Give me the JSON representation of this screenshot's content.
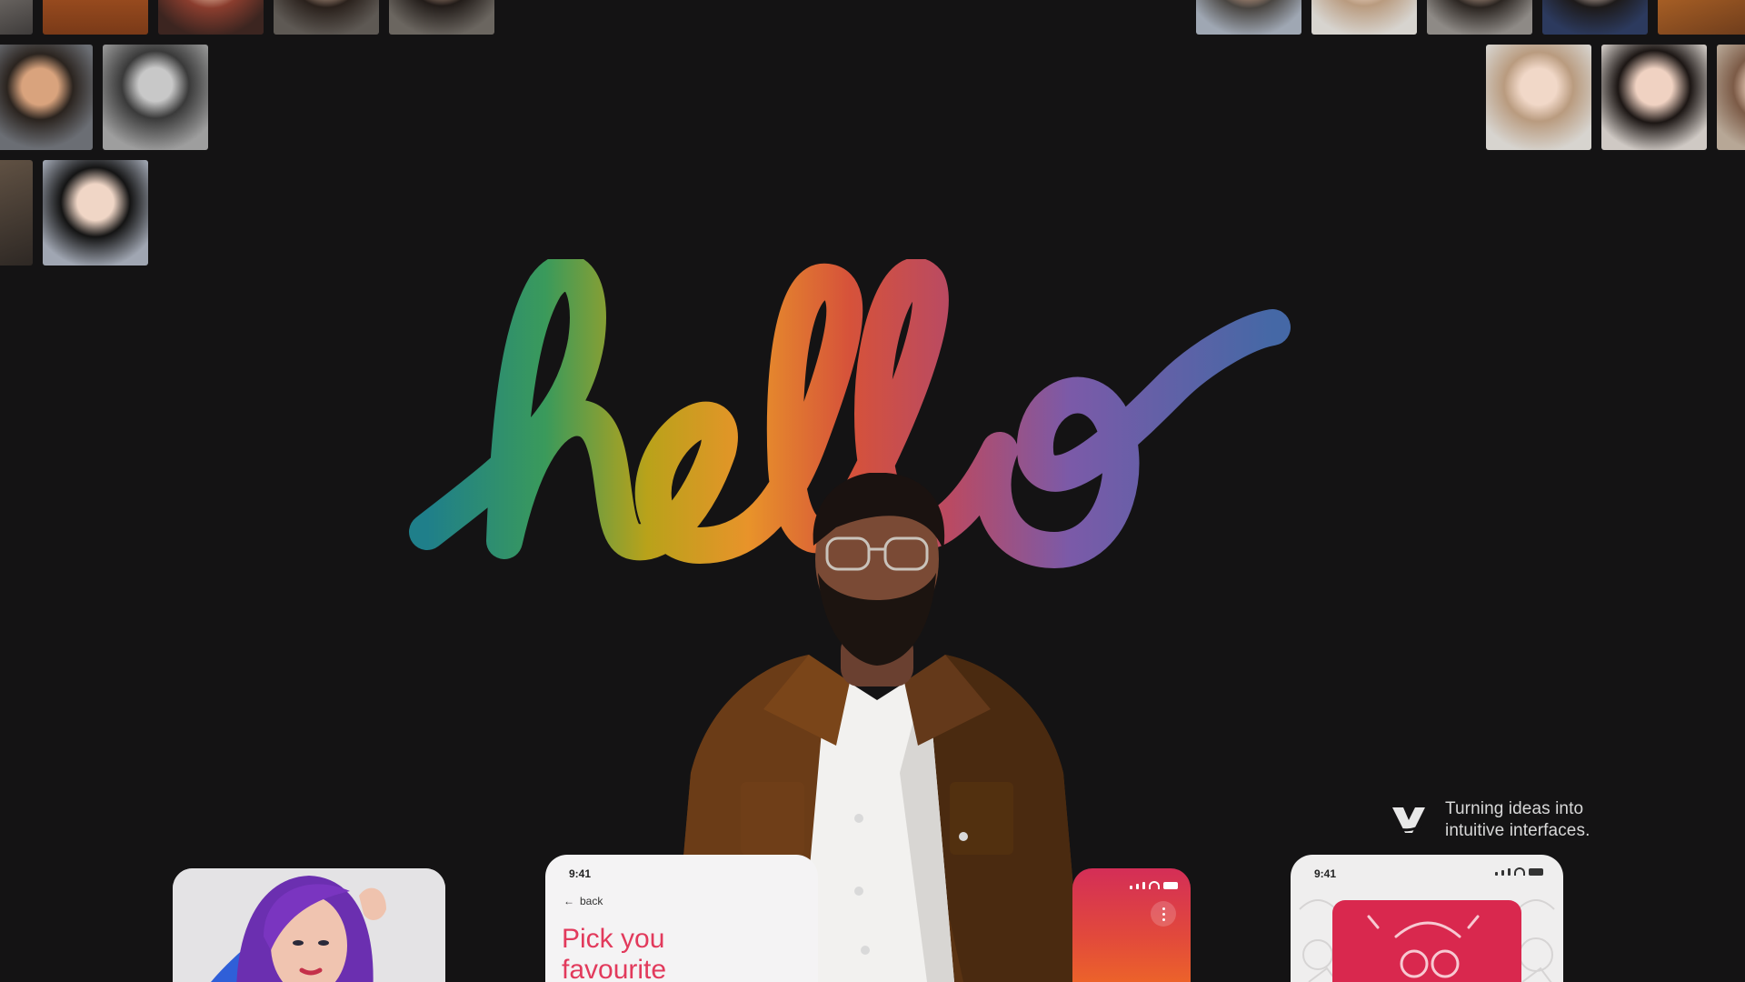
{
  "hero": {
    "word": "hello",
    "stroke_colors": [
      "#1f7f8a",
      "#3a9a5b",
      "#b9a21a",
      "#e8932a",
      "#d6523a",
      "#b94a63",
      "#7b5aa8",
      "#4568a6"
    ]
  },
  "tagline": {
    "line1": "Turning ideas into",
    "line2": "intuitive interfaces."
  },
  "cards": {
    "favourite": {
      "time": "9:41",
      "back_label": "back",
      "title_line1": "Pick you",
      "title_line2": "favourite"
    },
    "sticker": {
      "time": "9:41"
    }
  },
  "colors": {
    "background": "#141314",
    "accent_pink": "#e23a5c",
    "sticker_red": "#d9284e"
  }
}
